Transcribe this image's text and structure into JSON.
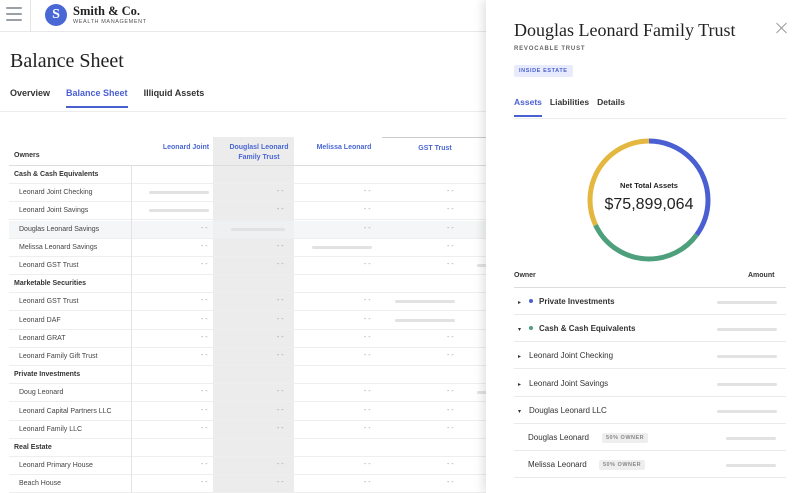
{
  "brand": {
    "initial": "S",
    "name": "Smith & Co.",
    "subtitle": "WEALTH MANAGEMENT"
  },
  "page": {
    "title": "Balance Sheet"
  },
  "tabs": [
    {
      "label": "Overview",
      "active": false
    },
    {
      "label": "Balance Sheet",
      "active": true
    },
    {
      "label": "Illiquid Assets",
      "active": false
    }
  ],
  "table": {
    "owners_label": "Owners",
    "columns": [
      "Leonard Joint",
      "Douglasl Leonard Family Trust",
      "Melissa Leonard",
      "GST Trust"
    ],
    "placeholder": "- -",
    "rows": [
      {
        "label": "Cash & Cash Equivalents",
        "section": true
      },
      {
        "label": "Leonard Joint Checking",
        "cells": [
          "bar",
          "- -",
          "- -",
          "- -"
        ]
      },
      {
        "label": "Leonard Joint Savings",
        "cells": [
          "bar",
          "- -",
          "- -",
          "- -"
        ]
      },
      {
        "label": "Douglas Leonard Savings",
        "cells": [
          "- -",
          "bar",
          "- -",
          "- -"
        ],
        "highlight": true
      },
      {
        "label": "Melissa Leonard Savings",
        "cells": [
          "- -",
          "- -",
          "bar",
          "- -"
        ]
      },
      {
        "label": "Leonard GST Trust",
        "cells": [
          "- -",
          "- -",
          "- -",
          "- -"
        ]
      },
      {
        "label": "Marketable Securities",
        "section": true
      },
      {
        "label": "Leonard GST Trust",
        "cells": [
          "- -",
          "- -",
          "- -",
          "bar"
        ]
      },
      {
        "label": "Leonard DAF",
        "cells": [
          "- -",
          "- -",
          "- -",
          "bar"
        ]
      },
      {
        "label": "Leonard GRAT",
        "cells": [
          "- -",
          "- -",
          "- -",
          "- -"
        ]
      },
      {
        "label": "Leonard Family Gift Trust",
        "cells": [
          "- -",
          "- -",
          "- -",
          "- -"
        ]
      },
      {
        "label": "Private Investments",
        "section": true
      },
      {
        "label": "Doug Leonard",
        "cells": [
          "- -",
          "- -",
          "- -",
          "- -"
        ]
      },
      {
        "label": "Leonard Capital Partners LLC",
        "cells": [
          "- -",
          "- -",
          "- -",
          "- -"
        ]
      },
      {
        "label": "Leonard Family LLC",
        "cells": [
          "- -",
          "- -",
          "- -",
          "- -"
        ]
      },
      {
        "label": "Real Estate",
        "section": true
      },
      {
        "label": "Leonard Primary House",
        "cells": [
          "- -",
          "- -",
          "- -",
          "- -"
        ]
      },
      {
        "label": "Beach House",
        "cells": [
          "- -",
          "- -",
          "- -",
          "- -"
        ]
      }
    ]
  },
  "panel": {
    "title": "Douglas Leonard Family Trust",
    "subtitle": "REVOCABLE TRUST",
    "badge": "INSIDE ESTATE",
    "tabs": [
      {
        "label": "Assets",
        "active": true
      },
      {
        "label": "Liabilities",
        "active": false
      },
      {
        "label": "Details",
        "active": false
      }
    ],
    "donut": {
      "label": "Net Total Assets",
      "value": "$75,899,064",
      "segments": [
        {
          "color": "#4a5fd1",
          "fraction": 0.35
        },
        {
          "color": "#4e9f7c",
          "fraction": 0.33
        },
        {
          "color": "#e3b740",
          "fraction": 0.32
        }
      ]
    },
    "list_owner_header": "Owner",
    "list_amount_header": "Amount",
    "list": [
      {
        "label": "Private Investments",
        "bold": true,
        "caret": "right",
        "dot": "#4a5fd1",
        "indent": 0
      },
      {
        "label": "Cash & Cash Equivalents",
        "bold": true,
        "caret": "down",
        "dot": "#4e9f7c",
        "indent": 0
      },
      {
        "label": "Leonard Joint Checking",
        "bold": false,
        "caret": "right",
        "indent": 0
      },
      {
        "label": "Leonard Joint Savings",
        "bold": false,
        "caret": "right",
        "indent": 0
      },
      {
        "label": "Douglas Leonard LLC",
        "bold": false,
        "caret": "down",
        "indent": 0
      },
      {
        "label": "Douglas Leonard",
        "bold": false,
        "tag": "50% OWNER",
        "indent": 1
      },
      {
        "label": "Melissa Leonard",
        "bold": false,
        "tag": "50% OWNER",
        "indent": 1
      }
    ]
  }
}
